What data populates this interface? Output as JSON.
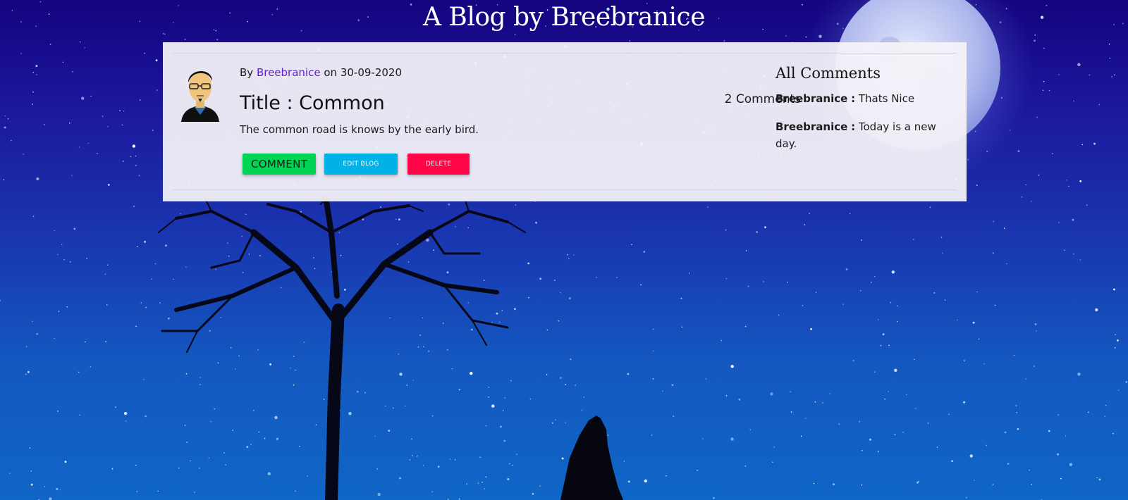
{
  "site": {
    "title": "A Blog by Breebranice"
  },
  "post": {
    "by_prefix": "By",
    "author": "Breebranice",
    "on_word": "on",
    "date": "30-09-2020",
    "title": "Title : Common",
    "body": "The common road is knows by the early bird.",
    "comment_count_label": "2 Comments",
    "actions": {
      "comment": "Comment",
      "edit": "Edit Blog",
      "delete": "Delete"
    }
  },
  "comments_panel": {
    "heading": "All Comments",
    "comments": [
      {
        "author": "Breebranice",
        "separator": ":",
        "text": "Thats Nice"
      },
      {
        "author": "Breebranice",
        "separator": ":",
        "text": "Today is a new day."
      }
    ]
  },
  "colors": {
    "author_link": "#5c1fd1",
    "comment_button": "#00d455",
    "edit_button": "#00b2e6",
    "delete_button": "#ff0547"
  },
  "icons": {
    "avatar": "cartoon-man-avatar",
    "background": "starry-night-wolf-scene"
  }
}
